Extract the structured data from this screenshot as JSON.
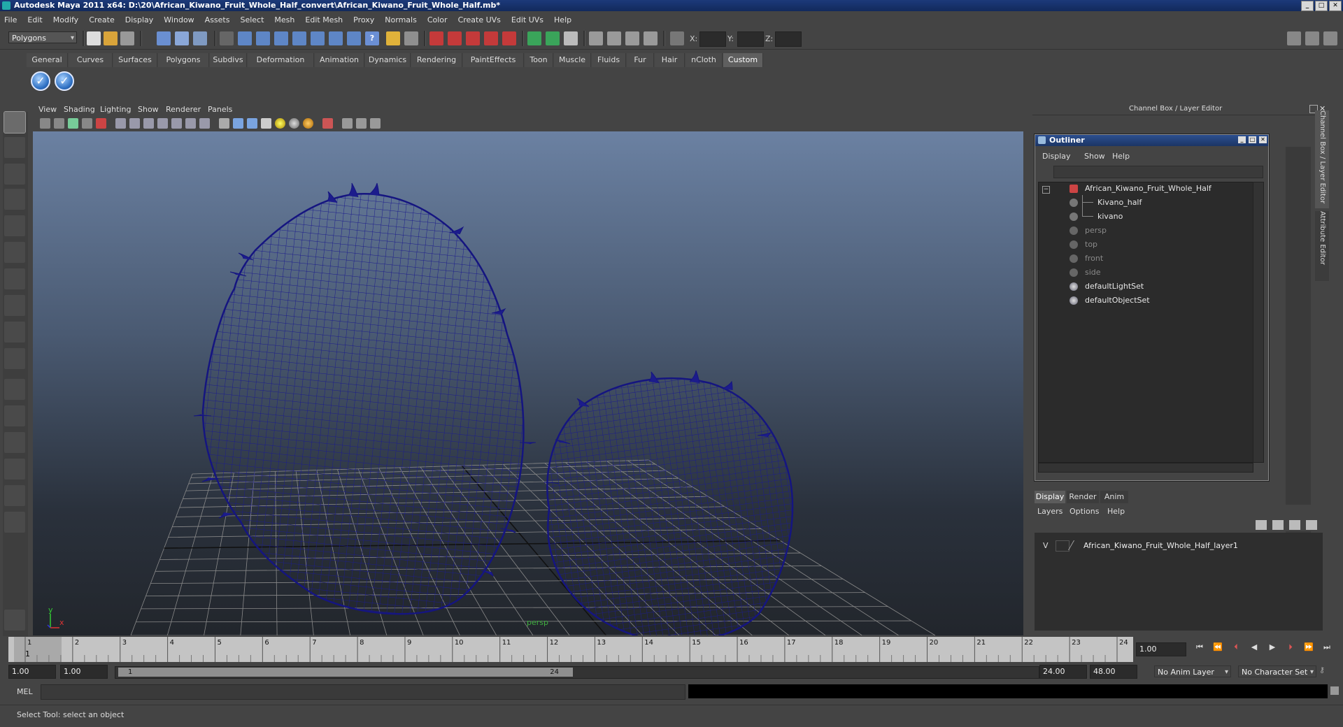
{
  "window": {
    "title": "Autodesk Maya 2011 x64: D:\\20\\African_Kiwano_Fruit_Whole_Half_convert\\African_Kiwano_Fruit_Whole_Half.mb*"
  },
  "menubar": [
    "File",
    "Edit",
    "Modify",
    "Create",
    "Display",
    "Window",
    "Assets",
    "Select",
    "Mesh",
    "Edit Mesh",
    "Proxy",
    "Normals",
    "Color",
    "Create UVs",
    "Edit UVs",
    "Help"
  ],
  "status": {
    "mode": "Polygons",
    "x_label": "X:",
    "y_label": "Y:",
    "z_label": "Z:"
  },
  "shelf_tabs": [
    "General",
    "Curves",
    "Surfaces",
    "Polygons",
    "Subdivs",
    "Deformation",
    "Animation",
    "Dynamics",
    "Rendering",
    "PaintEffects",
    "Toon",
    "Muscle",
    "Fluids",
    "Fur",
    "Hair",
    "nCloth",
    "Custom"
  ],
  "shelf_active": "Custom",
  "viewport": {
    "menu": [
      "View",
      "Shading",
      "Lighting",
      "Show",
      "Renderer",
      "Panels"
    ],
    "camera_label": "persp",
    "axis_y": "y",
    "axis_x": "x",
    "wire_color": "#1a1a8a"
  },
  "channel_box": {
    "title": "Channel Box / Layer Editor",
    "side_tab_1": "Channel Box / Layer Editor",
    "side_tab_2": "Attribute Editor"
  },
  "outliner": {
    "title": "Outliner",
    "menu": [
      "Display",
      "Show",
      "Help"
    ],
    "items": [
      {
        "label": "African_Kiwano_Fruit_Whole_Half",
        "dim": false
      },
      {
        "label": "Kivano_half",
        "dim": false
      },
      {
        "label": "kivano",
        "dim": false
      },
      {
        "label": "persp",
        "dim": true
      },
      {
        "label": "top",
        "dim": true
      },
      {
        "label": "front",
        "dim": true
      },
      {
        "label": "side",
        "dim": true
      },
      {
        "label": "defaultLightSet",
        "dim": false
      },
      {
        "label": "defaultObjectSet",
        "dim": false
      }
    ]
  },
  "layer_editor": {
    "tabs": [
      "Display",
      "Render",
      "Anim"
    ],
    "menu": [
      "Layers",
      "Options",
      "Help"
    ],
    "layer_visible": "V",
    "layer_name": "African_Kiwano_Fruit_Whole_Half_layer1"
  },
  "timeline": {
    "ticks": [
      "1",
      "2",
      "3",
      "4",
      "5",
      "6",
      "7",
      "8",
      "9",
      "10",
      "11",
      "12",
      "13",
      "14",
      "15",
      "16",
      "17",
      "18",
      "19",
      "20",
      "21",
      "22",
      "23",
      "24"
    ],
    "current_marker": "1",
    "current_frame": "1.00"
  },
  "range": {
    "start": "1.00",
    "playback_start": "1.00",
    "slider_start": "1",
    "slider_end": "24",
    "playback_end": "24.00",
    "end": "48.00",
    "anim_layer": "No Anim Layer",
    "character_set": "No Character Set"
  },
  "command_line": {
    "label": "MEL"
  },
  "help_line": {
    "text": "Select Tool: select an object"
  }
}
